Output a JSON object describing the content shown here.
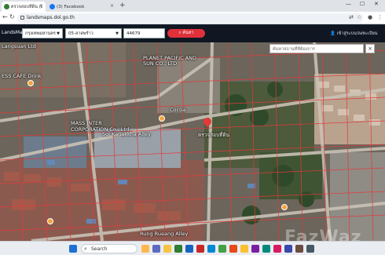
{
  "browser": {
    "tabs": [
      {
        "label": "ตรวจสอบที่ดิน (LandsMa…",
        "active": true
      },
      {
        "label": "(3) Facebook",
        "active": false
      }
    ],
    "url": "landsmaps.dol.go.th"
  },
  "app": {
    "brand": "LandsMaps",
    "province": "กรุงเทพมหานคร",
    "district": "05-ลาดพร้าว",
    "parcel_no": "44679",
    "search_label": "ค้นหา",
    "login_label": "เข้าสู่ระบบ/ลงทะเบียน"
  },
  "map": {
    "search_placeholder": "ค้นหาสถานที่ที่ต้องการ",
    "labels": {
      "langsuan": "Langsuan Ltd",
      "cafe": "ESS CAFE Drink",
      "planet": "PLANET PACIFIC AND SUN CO., LTD",
      "mass": "MASS INTER CORPORATION Co., Ltd",
      "cocoa": "Cocoa",
      "kanakkha": "Soi Kanakkha Alley",
      "rung": "Rung Rueang Alley",
      "parcel": "ตรวจสอบที่ดิน"
    },
    "watermark": "FazWaz"
  },
  "taskbar": {
    "search_label": "Search"
  },
  "colors": {
    "appbar": "#101722",
    "search_button": "#e0313b",
    "parcel_line": "#e23a3a",
    "pin": "#e53935"
  }
}
